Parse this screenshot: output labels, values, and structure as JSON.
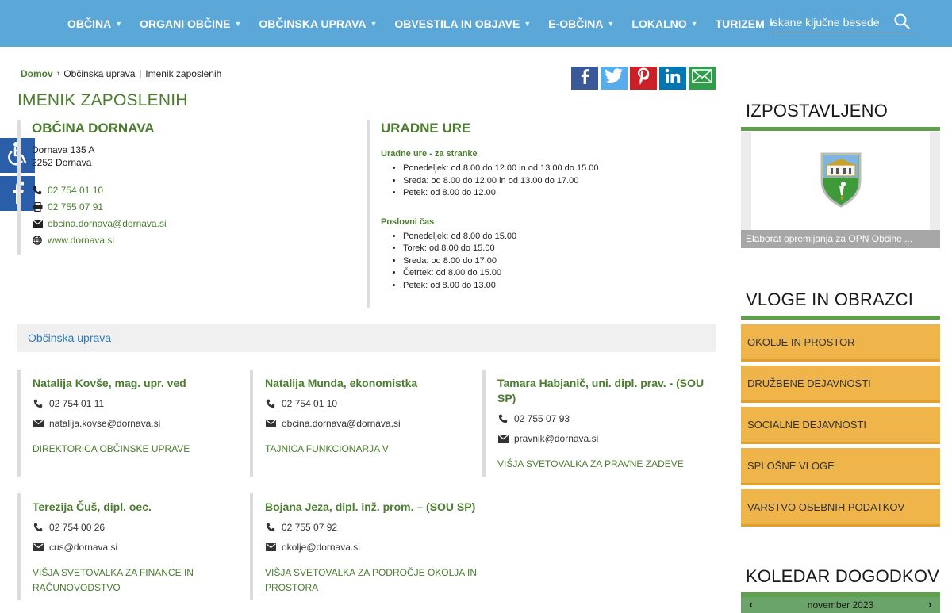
{
  "nav": {
    "items": [
      {
        "label": "OBČINA"
      },
      {
        "label": "ORGANI OBČINE"
      },
      {
        "label": "OBČINSKA UPRAVA"
      },
      {
        "label": "OBVESTILA IN OBJAVE"
      },
      {
        "label": "E-OBČINA"
      },
      {
        "label": "LOKALNO"
      },
      {
        "label": "TURIZEM"
      }
    ],
    "search_placeholder": "Iskane ključne besede",
    "caret": "▼"
  },
  "breadcrumb": {
    "home": "Domov",
    "separator": "›",
    "level1": "Občinska uprava",
    "divider": "|",
    "current": "Imenik zaposlenih"
  },
  "page_title": "IMENIK ZAPOSLENIH",
  "share": {
    "icons": [
      "facebook-icon",
      "twitter-icon",
      "pinterest-icon",
      "linkedin-icon",
      "email-icon"
    ],
    "colors": {
      "facebook": "#3b5998",
      "twitter": "#55acee",
      "pinterest": "#cb2027",
      "linkedin": "#0077b5",
      "email": "#2e9e4a"
    }
  },
  "municipality": {
    "title": "OBČINA DORNAVA",
    "address_line1": "Dornava 135 A",
    "address_line2": "2252 Dornava",
    "phone": "02 754 01 10",
    "fax": "02 755 07 91",
    "email": "obcina.dornava@dornava.si",
    "web": "www.dornava.si"
  },
  "office_hours": {
    "title": "URADNE URE",
    "customer_heading": "Uradne ure - za stranke",
    "customer_hours": [
      "Ponedeljek: od 8.00 do 12.00 in od 13.00 do 15.00",
      "Sreda: od 8.00 do 12.00 in od 13.00 do 17.00",
      "Petek: od 8.00 do 12.00"
    ],
    "business_heading": "Poslovni čas",
    "business_hours": [
      "Ponedeljek: od 8.00 do 15.00",
      "Torek: od 8.00 do 15.00",
      "Sreda: od 8.00 do 17.00",
      "Četrtek: od 8.00 do 15.00",
      "Petek: od 8.00 do 13.00"
    ]
  },
  "section": {
    "title": "Občinska uprava"
  },
  "employees": [
    {
      "name": "Natalija Kovše, mag. upr. ved",
      "phone": "02 754 01 11",
      "email": "natalija.kovse@dornava.si",
      "role": "DIREKTORICA OBČINSKE UPRAVE"
    },
    {
      "name": "Natalija Munda, ekonomistka",
      "phone": "02 754 01 10",
      "email": "obcina.dornava@dornava.si",
      "role": "TAJNICA FUNKCIONARJA V"
    },
    {
      "name": "Tamara Habjanič, uni. dipl. prav. - (SOU SP)",
      "phone": "02 755 07 93",
      "email": "pravnik@dornava.si",
      "role": "VIŠJA SVETOVALKA ZA PRAVNE ZADEVE"
    },
    {
      "name": "Terezija Čuš, dipl. oec.",
      "phone": "02 754 00 26",
      "email": "cus@dornava.si",
      "role": "VIŠJA SVETOVALKA ZA FINANCE IN RAČUNOVODSTVO"
    },
    {
      "name": "Bojana Jeza, dipl. inž. prom. – (SOU SP)",
      "phone": "02 755 07 92",
      "email": "okolje@dornava.si",
      "role": "VIŠJA SVETOVALKA ZA PODROČJE OKOLJA IN PROSTORA"
    }
  ],
  "sidebar": {
    "featured_title": "IZPOSTAVLJENO",
    "featured_caption": "Elaborat opremljanja za OPN Občine ...",
    "forms_title": "VLOGE IN OBRAZCI",
    "forms": [
      {
        "label": "OKOLJE IN PROSTOR"
      },
      {
        "label": "DRUŽBENE DEJAVNOSTI"
      },
      {
        "label": "SOCIALNE DEJAVNOSTI"
      },
      {
        "label": "SPLOŠNE VLOGE"
      },
      {
        "label": "VARSTVO OSEBNIH PODATKOV"
      }
    ],
    "calendar_title": "KOLEDAR DOGODKOV",
    "calendar_month": "november 2023",
    "prev": "‹",
    "next": "›"
  },
  "colors": {
    "nav": "#5ba8d8",
    "green": "#4a7d2e",
    "accent_bar": "#5fa04b",
    "form_button": "#efb54a",
    "link_blue": "#2b7bb9"
  }
}
